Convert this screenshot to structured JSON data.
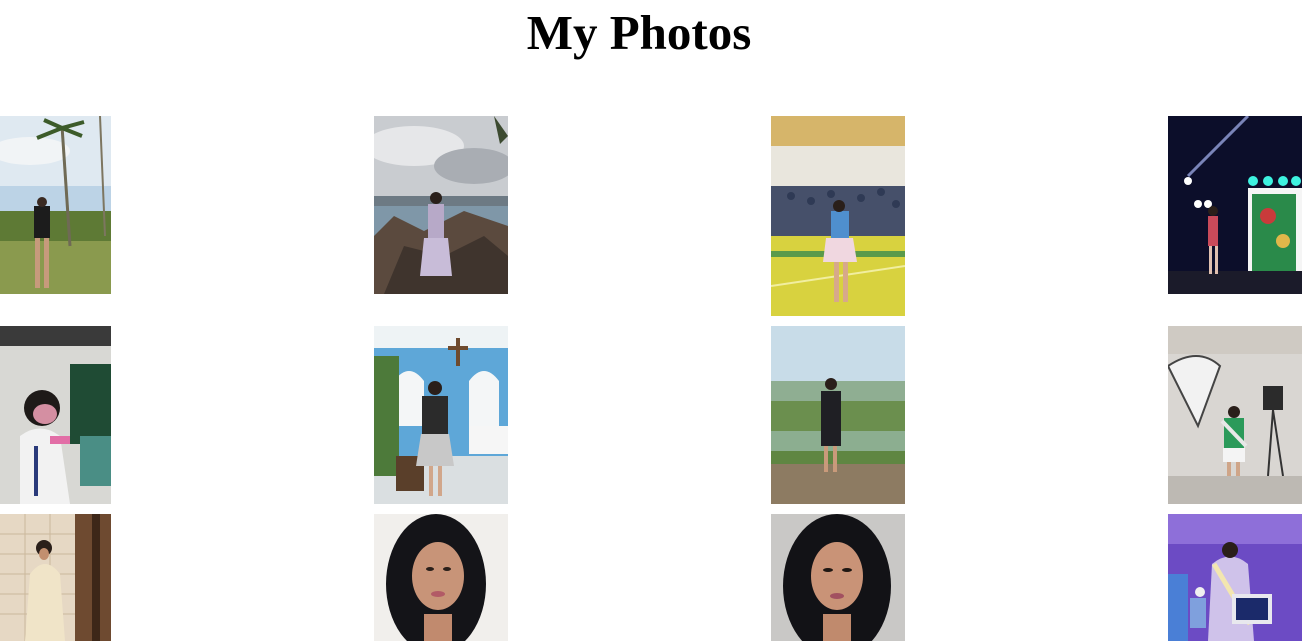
{
  "page": {
    "title": "My Photos"
  },
  "gallery": {
    "photos": [
      {
        "alt": "photo-1",
        "scene": "palm-field"
      },
      {
        "alt": "photo-2",
        "scene": "seaside-rocks"
      },
      {
        "alt": "photo-3",
        "scene": "gym-court"
      },
      {
        "alt": "photo-4",
        "scene": "stage-lights"
      },
      {
        "alt": "photo-5",
        "scene": "classroom"
      },
      {
        "alt": "photo-6",
        "scene": "blue-chapel"
      },
      {
        "alt": "photo-7",
        "scene": "green-field"
      },
      {
        "alt": "photo-8",
        "scene": "studio"
      },
      {
        "alt": "photo-9",
        "scene": "wood-panel"
      },
      {
        "alt": "photo-10",
        "scene": "portrait-light"
      },
      {
        "alt": "photo-11",
        "scene": "portrait-grey"
      },
      {
        "alt": "photo-12",
        "scene": "pageant-purple"
      }
    ]
  }
}
